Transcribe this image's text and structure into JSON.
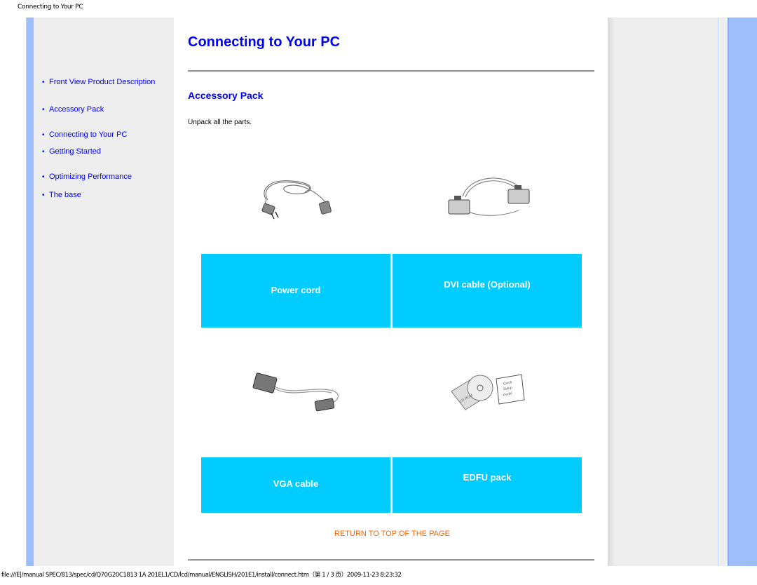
{
  "header": {
    "title": "Connecting to Your PC"
  },
  "sidebar": {
    "items": [
      {
        "label": "Front View Product Description"
      },
      {
        "label": "Accessory Pack"
      },
      {
        "label": "Connecting to Your PC"
      },
      {
        "label": "Getting Started"
      },
      {
        "label": "Optimizing Performance"
      },
      {
        "label": "The base"
      }
    ]
  },
  "main": {
    "title": "Connecting to Your PC",
    "section_title": "Accessory Pack",
    "intro": "Unpack all the parts.",
    "items": [
      {
        "label": "Power cord",
        "icon": "power-cord-image"
      },
      {
        "label": "DVI cable (Optional)",
        "icon": "dvi-cable-image"
      },
      {
        "label": "VGA cable",
        "icon": "vga-cable-image"
      },
      {
        "label": "EDFU pack",
        "icon": "edfu-pack-image"
      }
    ],
    "edfu_cd_label": "CD-ROM",
    "edfu_guide_label": "Quick Setup Guide",
    "return_link": "RETURN TO TOP OF THE PAGE"
  },
  "colors": {
    "link": "#0000ff",
    "label_box": "#00ccff",
    "return_link": "#ff6600",
    "side_bar": "#9dbdfa",
    "panel": "#eeeeee"
  },
  "footer": {
    "path": "file:///E|/manual SPEC/813/spec/cd/Q70G20C1813 1A 201EL1/CD/lcd/manual/ENGLISH/201E1/install/connect.htm（第 1 / 3 页）2009-11-23 8:23:32"
  }
}
